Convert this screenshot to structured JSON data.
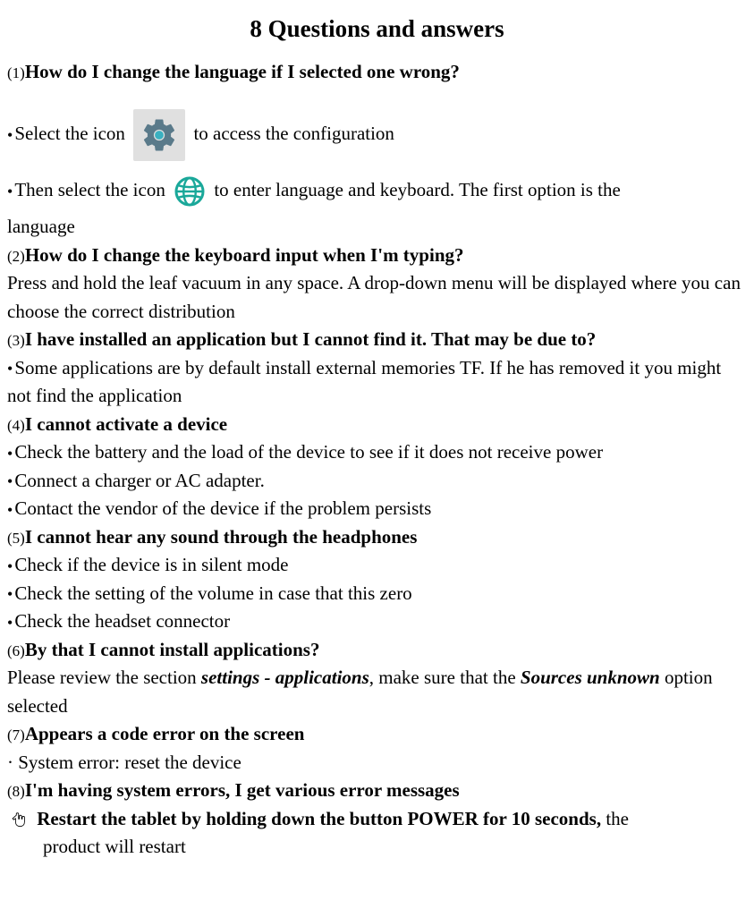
{
  "title": "8 Questions and answers",
  "q1": {
    "num": "(1)",
    "question": "How do I change the language if I selected one wrong?",
    "line1_before": "Select the icon ",
    "line1_after": "to access the configuration",
    "line2_before": "Then select the icon ",
    "line2_after": " to enter language and keyboard. The first option is the",
    "line3": "language"
  },
  "q2": {
    "num": "(2)",
    "question": "How do I change the keyboard input when I'm typing?",
    "answer": "Press and hold the leaf vacuum in any space. A drop-down menu will be displayed where you can choose the correct distribution"
  },
  "q3": {
    "num": "(3)",
    "question": "I have installed an application but I cannot find it. That may be due to?",
    "bullet1": "Some applications are by default install external memories TF. If he has removed it you might not find the application"
  },
  "q4": {
    "num": "(4)",
    "question": "I cannot activate a device",
    "bullet1": "Check the battery and the load of the device to see if it does not receive power",
    "bullet2": "Connect a charger or AC adapter.",
    "bullet3": "Contact the vendor of the device if the problem persists"
  },
  "q5": {
    "num": "(5)",
    "question": "I cannot hear any sound through the headphones",
    "bullet1": "Check if the device is in silent mode",
    "bullet2": "Check the setting of the volume in case that this zero",
    "bullet3": "Check the headset connector"
  },
  "q6": {
    "num": "(6)",
    "question": "By that I cannot install applications?",
    "answer_pre": "Please review the section ",
    "answer_emph1": "settings - applications",
    "answer_mid": ", make sure that the ",
    "answer_emph2": "Sources unknown",
    "answer_post": " option selected"
  },
  "q7": {
    "num": "(7)",
    "question": "Appears a code error on the screen",
    "bullet1_prefix": "· ",
    "bullet1": "System error: reset the device"
  },
  "q8": {
    "num": "(8)",
    "question": "I'm having system errors, I get various error messages",
    "answer_bold": "Restart the tablet by holding down the button POWER for 10 seconds,",
    "answer_rest": " the",
    "answer_cont": "product will restart"
  }
}
